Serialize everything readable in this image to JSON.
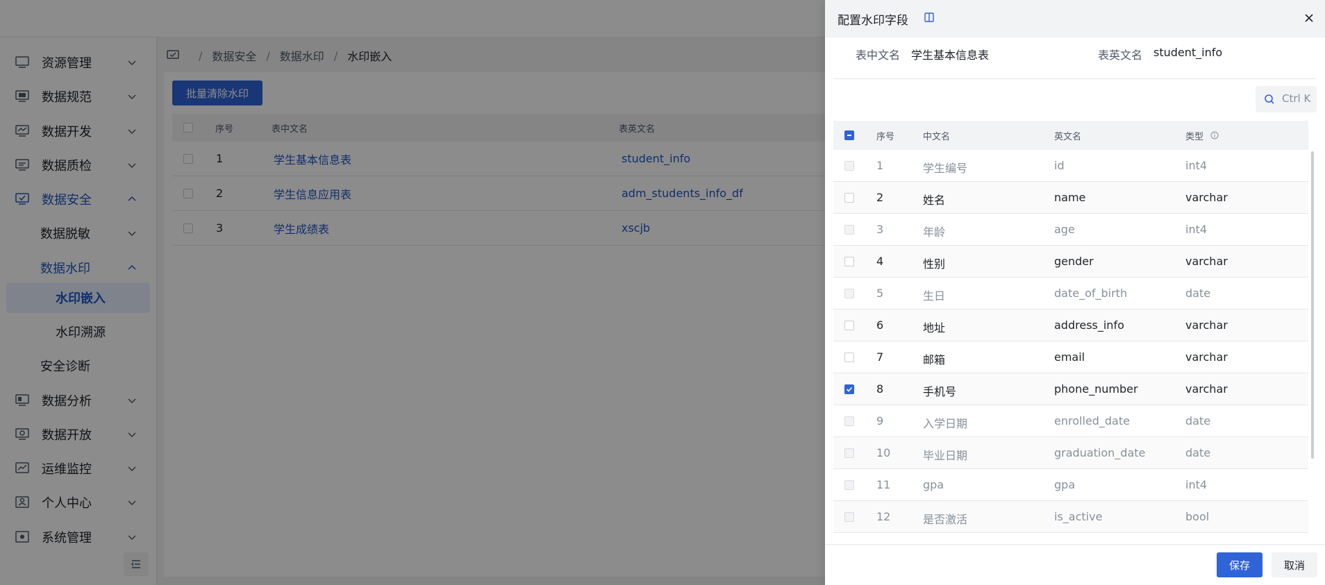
{
  "sidebar": {
    "items": [
      {
        "label": "资源管理",
        "icon": "monitor-icon"
      },
      {
        "label": "数据规范",
        "icon": "standard-icon"
      },
      {
        "label": "数据开发",
        "icon": "dev-icon"
      },
      {
        "label": "数据质检",
        "icon": "quality-icon"
      },
      {
        "label": "数据安全",
        "icon": "security-icon"
      },
      {
        "label": "数据脱敏"
      },
      {
        "label": "数据水印"
      },
      {
        "label": "水印嵌入"
      },
      {
        "label": "水印溯源"
      },
      {
        "label": "安全诊断"
      },
      {
        "label": "数据分析",
        "icon": "analysis-icon"
      },
      {
        "label": "数据开放",
        "icon": "open-icon"
      },
      {
        "label": "运维监控",
        "icon": "monitor-chart-icon"
      },
      {
        "label": "个人中心",
        "icon": "user-icon"
      },
      {
        "label": "系统管理",
        "icon": "settings-icon"
      }
    ]
  },
  "breadcrumb": [
    "数据安全",
    "数据水印",
    "水印嵌入"
  ],
  "base": {
    "clear_button": "批量清除水印",
    "columns": [
      "序号",
      "表中文名",
      "表英文名"
    ],
    "rows": [
      {
        "no": "1",
        "cn": "学生基本信息表",
        "en": "student_info"
      },
      {
        "no": "2",
        "cn": "学生信息应用表",
        "en": "adm_students_info_df"
      },
      {
        "no": "3",
        "cn": "学生成绩表",
        "en": "xscjb"
      }
    ]
  },
  "drawer": {
    "title": "配置水印字段",
    "table_cn_label": "表中文名",
    "table_cn_value": "学生基本信息表",
    "table_en_label": "表英文名",
    "table_en_value": "student_info",
    "search_placeholder": "Ctrl K",
    "columns": {
      "no": "序号",
      "cn": "中文名",
      "en": "英文名",
      "type": "类型"
    },
    "fields": [
      {
        "no": "1",
        "cn": "学生编号",
        "en": "id",
        "type": "int4",
        "state": "disabled"
      },
      {
        "no": "2",
        "cn": "姓名",
        "en": "name",
        "type": "varchar",
        "state": "unchecked"
      },
      {
        "no": "3",
        "cn": "年龄",
        "en": "age",
        "type": "int4",
        "state": "disabled"
      },
      {
        "no": "4",
        "cn": "性别",
        "en": "gender",
        "type": "varchar",
        "state": "unchecked"
      },
      {
        "no": "5",
        "cn": "生日",
        "en": "date_of_birth",
        "type": "date",
        "state": "disabled"
      },
      {
        "no": "6",
        "cn": "地址",
        "en": "address_info",
        "type": "varchar",
        "state": "unchecked"
      },
      {
        "no": "7",
        "cn": "邮箱",
        "en": "email",
        "type": "varchar",
        "state": "unchecked"
      },
      {
        "no": "8",
        "cn": "手机号",
        "en": "phone_number",
        "type": "varchar",
        "state": "checked"
      },
      {
        "no": "9",
        "cn": "入学日期",
        "en": "enrolled_date",
        "type": "date",
        "state": "disabled"
      },
      {
        "no": "10",
        "cn": "毕业日期",
        "en": "graduation_date",
        "type": "date",
        "state": "disabled"
      },
      {
        "no": "11",
        "cn": "gpa",
        "en": "gpa",
        "type": "int4",
        "state": "disabled"
      },
      {
        "no": "12",
        "cn": "是否激活",
        "en": "is_active",
        "type": "bool",
        "state": "disabled"
      }
    ],
    "save_label": "保存",
    "cancel_label": "取消"
  },
  "colors": {
    "primary": "#2f63d8",
    "active_text": "#1f57c3",
    "overlay": "rgba(0,0,0,0.45)"
  }
}
